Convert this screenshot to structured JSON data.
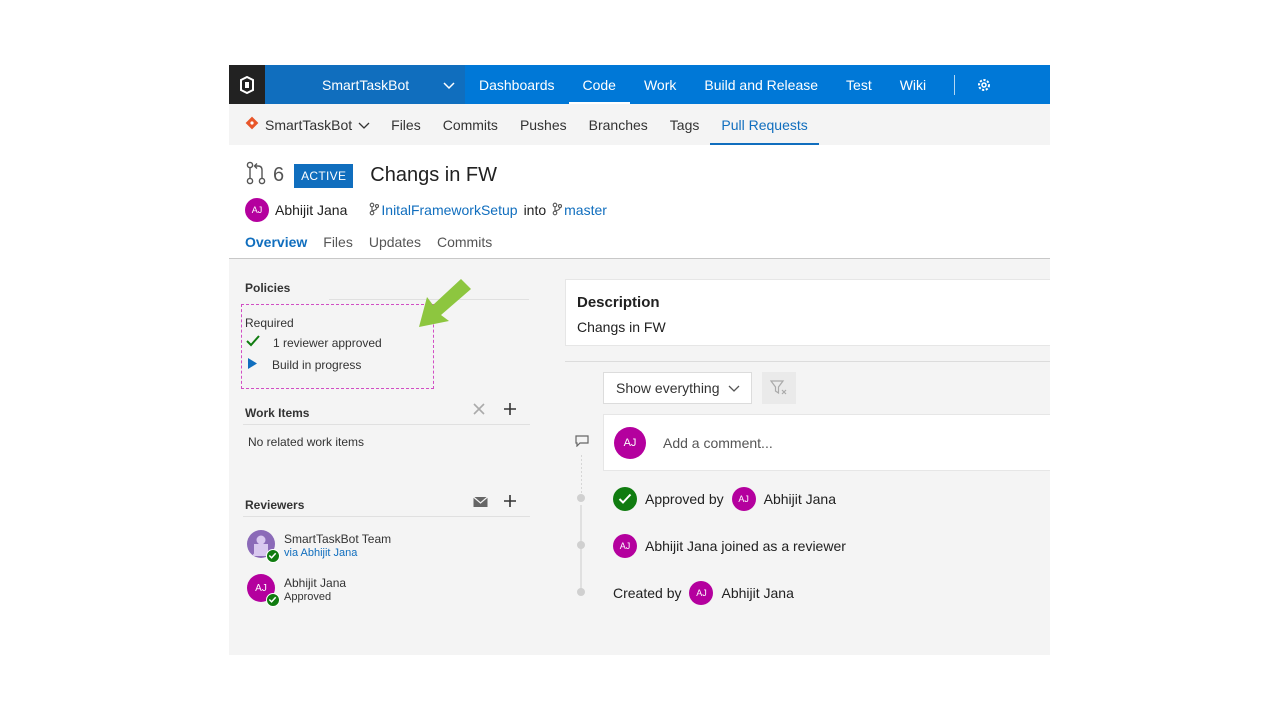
{
  "colors": {
    "brand": "#0078d7",
    "link": "#106ebe",
    "avatar": "#b4009e",
    "approved": "#107c10",
    "arrow": "#8dc63f"
  },
  "topbar": {
    "project": "SmartTaskBot",
    "nav": [
      "Dashboards",
      "Code",
      "Work",
      "Build and Release",
      "Test",
      "Wiki"
    ],
    "active": "Code"
  },
  "subnav": {
    "repo": "SmartTaskBot",
    "items": [
      "Files",
      "Commits",
      "Pushes",
      "Branches",
      "Tags",
      "Pull Requests"
    ],
    "active": "Pull Requests"
  },
  "pr": {
    "number": "6",
    "status": "ACTIVE",
    "title": "Changs in FW",
    "author_initials": "AJ",
    "author": "Abhijit Jana",
    "source_branch": "InitalFrameworkSetup",
    "into_label": "into",
    "target_branch": "master",
    "tabs": [
      "Overview",
      "Files",
      "Updates",
      "Commits"
    ],
    "active_tab": "Overview"
  },
  "policies": {
    "heading": "Policies",
    "required_label": "Required",
    "items": [
      {
        "text": "1 reviewer approved",
        "icon": "check-icon"
      },
      {
        "text": "Build in progress",
        "icon": "play-icon"
      }
    ]
  },
  "work_items": {
    "heading": "Work Items",
    "empty_text": "No related work items"
  },
  "reviewers": {
    "heading": "Reviewers",
    "list": [
      {
        "name": "SmartTaskBot Team",
        "sub": "via Abhijit Jana",
        "initials": ""
      },
      {
        "name": "Abhijit Jana",
        "sub": "Approved",
        "initials": "AJ"
      }
    ]
  },
  "description": {
    "heading": "Description",
    "text": "Changs in FW"
  },
  "activity": {
    "filter": "Show everything",
    "comment_placeholder": "Add a comment...",
    "comment_initials": "AJ",
    "timeline": [
      {
        "prefix": "Approved by",
        "initials": "AJ",
        "name": "Abhijit Jana",
        "suffix": ""
      },
      {
        "prefix": "",
        "initials": "AJ",
        "name": "Abhijit Jana",
        "suffix": "joined as a reviewer"
      },
      {
        "prefix": "Created by",
        "initials": "AJ",
        "name": "Abhijit Jana",
        "suffix": ""
      }
    ]
  }
}
